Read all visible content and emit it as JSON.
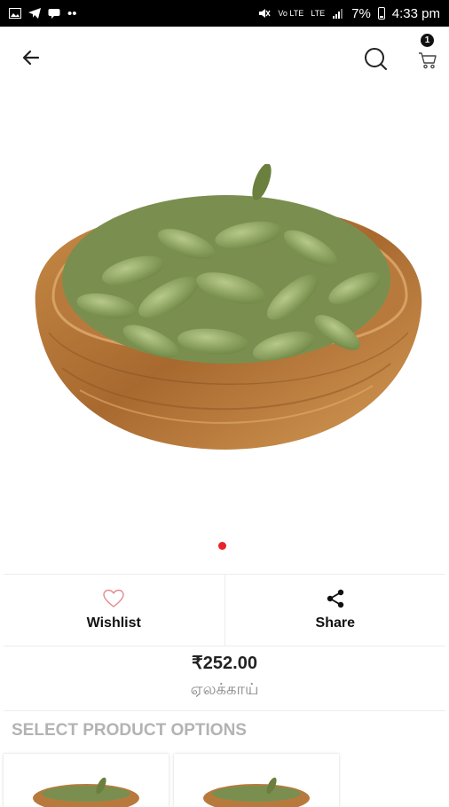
{
  "status_bar": {
    "time": "4:33 pm",
    "battery": "7%",
    "network_labels": [
      "Vo LTE",
      "LTE"
    ]
  },
  "header": {
    "cart_count": "1"
  },
  "carousel": {
    "image_alt": "cardamom pods in wooden bowl"
  },
  "actions": {
    "wishlist_label": "Wishlist",
    "share_label": "Share"
  },
  "product": {
    "price": "₹252.00",
    "name": "ஏலக்காய்"
  },
  "options": {
    "title": "SELECT PRODUCT OPTIONS"
  }
}
